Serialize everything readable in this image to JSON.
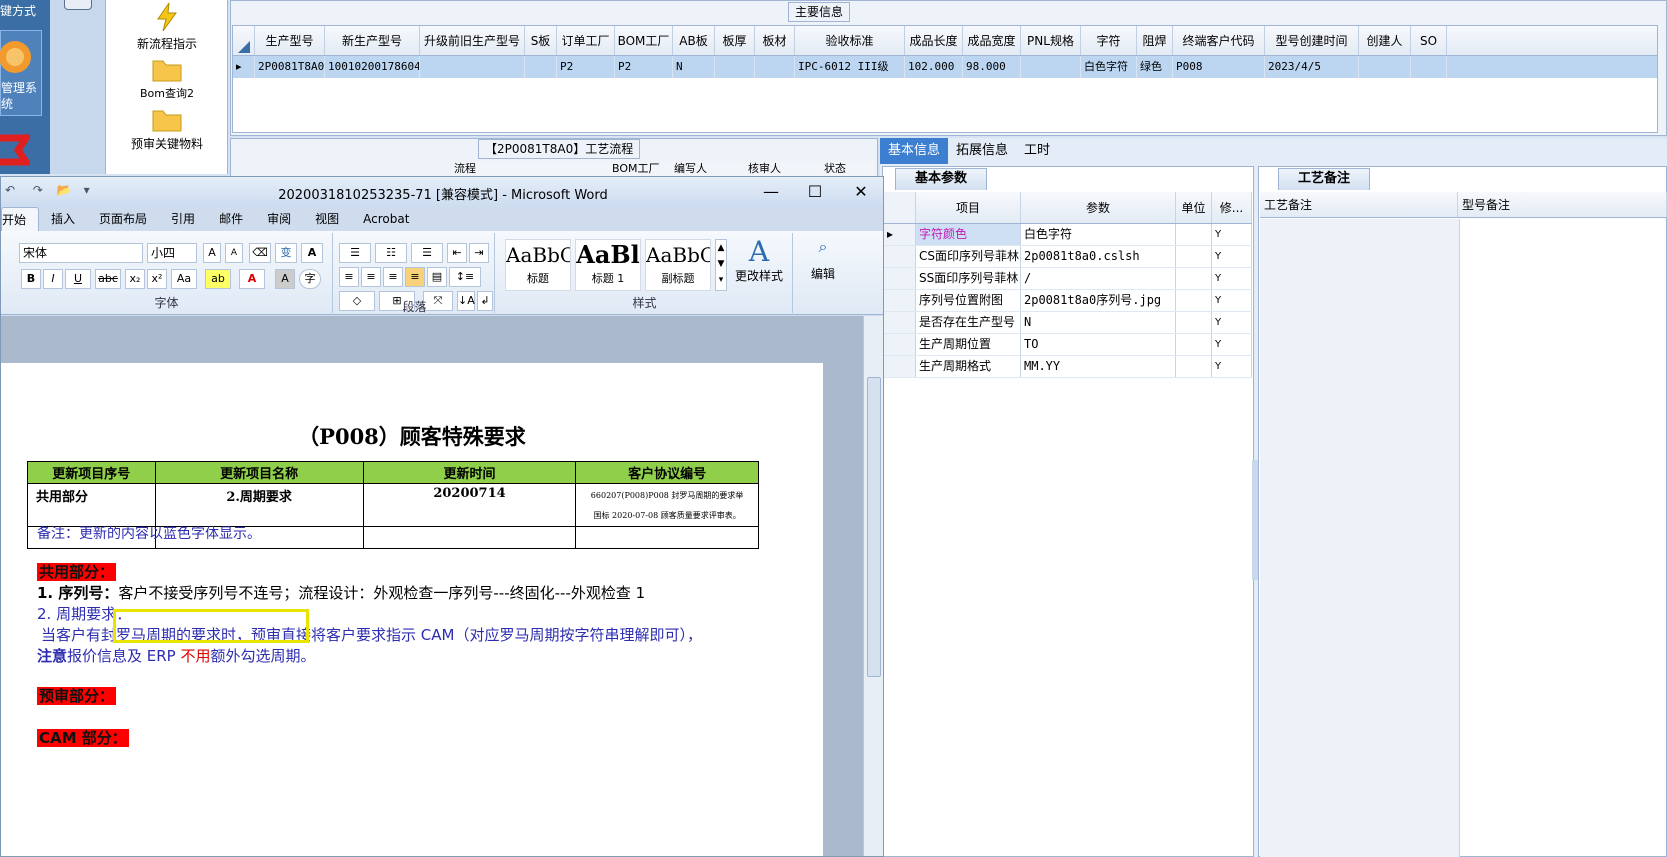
{
  "desktop": {
    "left_labels": [
      "键方式",
      "管理系",
      "统"
    ],
    "icons": [
      {
        "label": "新流程指示",
        "icon": "lightning-icon"
      },
      {
        "label": "Bom查询2",
        "icon": "folder-icon"
      },
      {
        "label": "预审关键物料",
        "icon": "folder-icon"
      }
    ]
  },
  "main_info": {
    "caption": "主要信息",
    "columns": [
      "生产型号",
      "新生产型号",
      "升级前旧生产型号",
      "S板",
      "订单工厂",
      "BOM工厂",
      "AB板",
      "板厚",
      "板材",
      "验收标准",
      "成品长度",
      "成品宽度",
      "PNL规格",
      "字符",
      "阻焊",
      "终端客户代码",
      "型号创建时间",
      "创建人",
      "SO"
    ],
    "row": [
      "2P0081T8A0",
      "10010200178604",
      "",
      "",
      "P2",
      "P2",
      "N",
      "",
      "",
      "IPC-6012 III级",
      "102.000",
      "98.000",
      "",
      "白色字符",
      "绿色",
      "P008",
      "2023/4/5",
      "",
      ""
    ]
  },
  "process": {
    "caption": "【2P0081T8A0】工艺流程",
    "columns": [
      "流程",
      "BOM工厂",
      "编写人",
      "核审人",
      "状态"
    ]
  },
  "right_tabs": [
    "基本信息",
    "拓展信息",
    "工时"
  ],
  "basic_params": {
    "tab": "基本参数",
    "columns": [
      "项目",
      "参数",
      "单位",
      "修..."
    ],
    "rows": [
      {
        "item": "字符颜色",
        "value": "白色字符",
        "unit": "",
        "mod": "Y"
      },
      {
        "item": "CS面印序列号菲林",
        "value": "2p0081t8a0.cslsh",
        "unit": "",
        "mod": "Y"
      },
      {
        "item": "SS面印序列号菲林",
        "value": "/",
        "unit": "",
        "mod": "Y"
      },
      {
        "item": "序列号位置附图",
        "value": "2p0081t8a0序列号.jpg",
        "unit": "",
        "mod": "Y"
      },
      {
        "item": "是否存在生产型号",
        "value": "N",
        "unit": "",
        "mod": "Y"
      },
      {
        "item": "生产周期位置",
        "value": "TO",
        "unit": "",
        "mod": "Y"
      },
      {
        "item": "生产周期格式",
        "value": "MM.YY",
        "unit": "",
        "mod": "Y"
      }
    ]
  },
  "craft_notes": {
    "tab": "工艺备注",
    "columns": [
      "工艺备注",
      "型号备注"
    ]
  },
  "word": {
    "title": "2020031810253235-71 [兼容模式] - Microsoft Word",
    "tabs": [
      "开始",
      "插入",
      "页面布局",
      "引用",
      "邮件",
      "审阅",
      "视图",
      "Acrobat"
    ],
    "font_name": "宋体",
    "font_size": "小四",
    "groups": {
      "font": "字体",
      "paragraph": "段落",
      "styles": "样式"
    },
    "styles": [
      {
        "sample": "AaBbC",
        "name": "标题"
      },
      {
        "sample": "AaBl",
        "name": "标题 1"
      },
      {
        "sample": "AaBbC",
        "name": "副标题"
      }
    ],
    "change_styles": "更改样式",
    "edit": "编辑"
  },
  "document": {
    "title": "（P008）顾客特殊要求",
    "table_headers": [
      "更新项目序号",
      "更新项目名称",
      "更新时间",
      "客户协议编号"
    ],
    "table_row": [
      "共用部分",
      "2.周期要求",
      "20200714",
      "660207(P008)P008 封罗马周期的要求举\n国标 2020-07-08 顾客质量要求评审表。"
    ],
    "note": "备注：更新的内容以蓝色字体显示。",
    "sec_common": "共用部分：",
    "line1_prefix": "1. 序列号：",
    "line1_highlight": "客户不接受序列号不连号",
    "line1_suffix": "；流程设计：外观检查一序列号---终固化---外观检查 1",
    "line2": "2. 周期要求：",
    "line3": "当客户有封罗马周期的要求时，预审直接将客户要求指示 CAM（对应罗马周期按字符串理解即可），",
    "line4_bold": "注意",
    "line4_a": "报价信息及 ERP ",
    "line4_red": "不用",
    "line4_b": "额外勾选周期。",
    "sec_pre": "预审部分：",
    "sec_cam": "CAM 部分："
  }
}
